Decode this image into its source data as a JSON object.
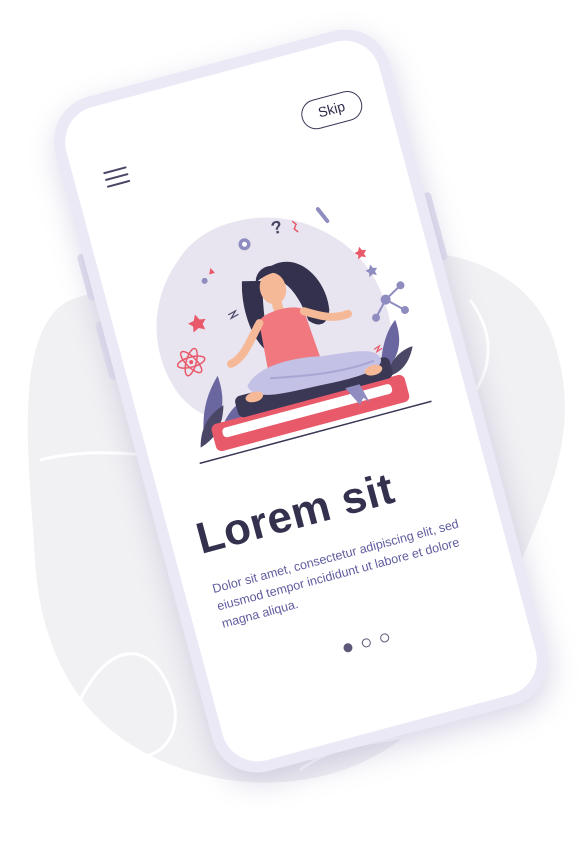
{
  "header": {
    "skip_label": "Skip"
  },
  "content": {
    "title": "Lorem sit",
    "description": "Dolor sit amet, consectetur adipiscing elit, sed eiusmod tempor incididunt ut labore et dolore magna aliqua."
  },
  "pagination": {
    "total_pages": 3,
    "active_page": 1
  },
  "icons": {
    "menu": "hamburger-menu-icon",
    "illustration": "meditating-woman-illustration"
  },
  "colors": {
    "text_dark": "#34314f",
    "text_purple": "#5f5c9e",
    "frame": "#ebe9f6",
    "accent_coral": "#e8596a",
    "blob": "#e8e4f0"
  }
}
